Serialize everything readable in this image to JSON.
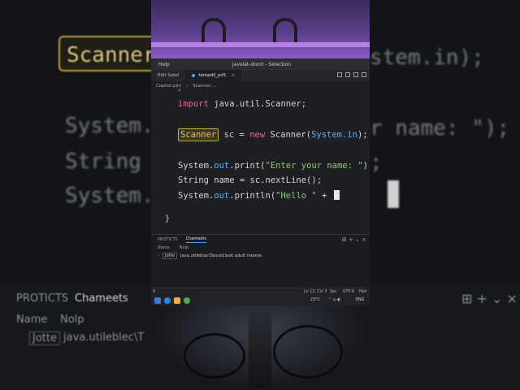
{
  "background": {
    "left_code": [
      "Scanner",
      "System.ou",
      "String n",
      "System.ou"
    ],
    "right_code": [
      "stem.in);",
      "r name: \");",
      ";",
      ""
    ],
    "panel": {
      "tab_left": "PROTICTS",
      "tab_active": "Chameets",
      "col1": "Name",
      "col2": "Nolp",
      "row_badge": "Jotte",
      "row_text": "java.utileblec\\T"
    }
  },
  "window": {
    "menu_help": "Help",
    "title": "javelat-dront - Selection",
    "tabs": [
      {
        "label": "Edit Satel"
      },
      {
        "label": "tempdil_pd1",
        "close": "×"
      }
    ],
    "breadcrumb": {
      "root": "Copilot.pinl",
      "separator": "›",
      "item": "Scanner ..."
    },
    "code": {
      "import_kw": "import",
      "import_path": " java.util.Scanner;",
      "l2_class": "Scanner",
      "l2_a": " sc = ",
      "l2_new": "new",
      "l2_b": " Scanner(",
      "l2_sys": "System.in",
      "l2_c": ");",
      "l3_sys": "System.",
      "l3_out": "out",
      "l3_dot": ".",
      "l3_fn": "print",
      "l3_open": "(",
      "l3_str": "\"Enter your name: \"",
      "l3_close": ");",
      "l4_a": "String name = sc.",
      "l4_fn": "nextLine",
      "l4_b": "();",
      "l5_sys": "System.",
      "l5_out": "out",
      "l5_dot": ".",
      "l5_fn": "println",
      "l5_open": "(",
      "l5_str": "\"Hello \"",
      "l5_plus": " + ",
      "brace": "}",
      "gutter": "#"
    },
    "panel": {
      "tab1": "PROTICTS",
      "tab2": "Chameets",
      "icons": "⊞ + ⌄ ×",
      "col_name": "Name",
      "col_nolp": "Nolp",
      "chevron": "›",
      "row_badge": "Jotte",
      "row_text": "java.utileblac\\Tance\\llook adult meone."
    },
    "status": {
      "left": "0",
      "pos": "Ln 13, Col 3",
      "spaces": "Spc",
      "enc": "UTF-8",
      "lang": "Hen"
    }
  },
  "taskbar": {
    "weather": "23°C",
    "tray": "⌃ ◎ ◐",
    "lang": "ENG"
  }
}
